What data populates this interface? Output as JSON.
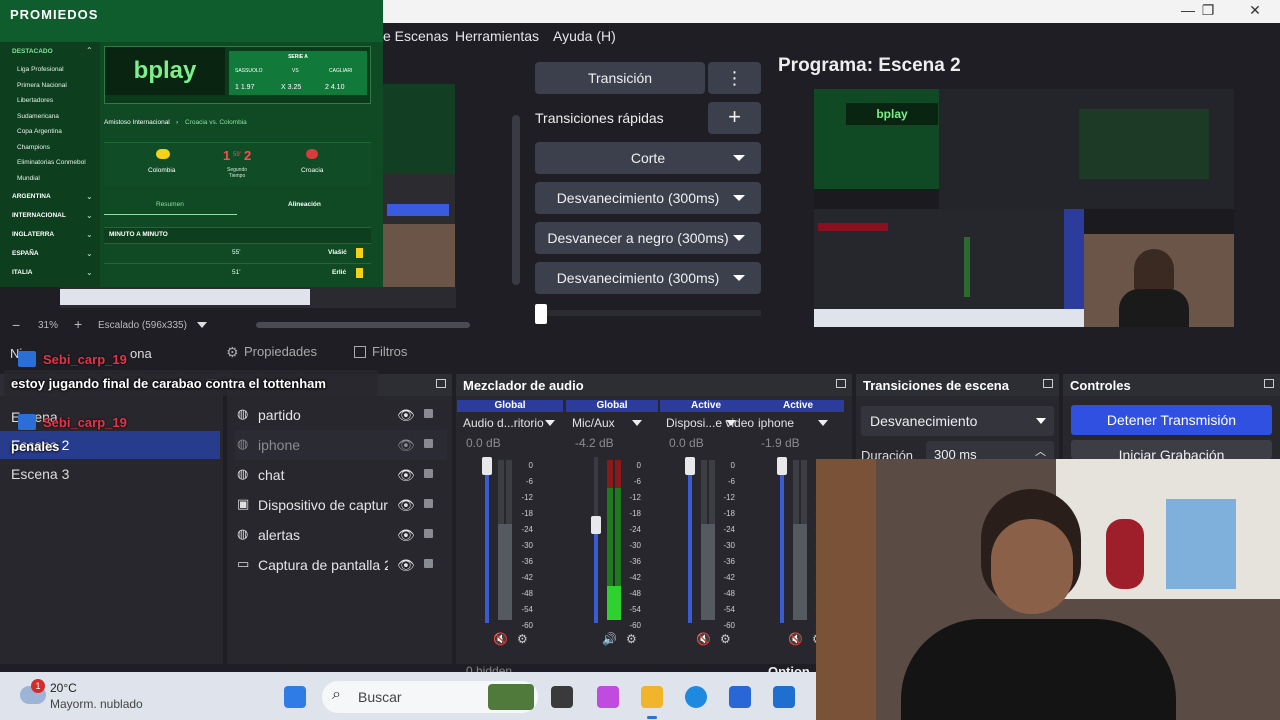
{
  "app": {
    "menu": [
      "e Escenas",
      "Herramientas",
      "Ayuda (H)"
    ],
    "program_title": "Programa: Escena 2"
  },
  "promiedos": {
    "logo": "PROMIEDOS",
    "sidebar_header": "DESTACADO",
    "sidebar_items": [
      "Liga Profesional",
      "Primera Nacional",
      "Libertadores",
      "Sudamericana",
      "Copa Argentina",
      "Champions",
      "Eliminatorias Conmebol",
      "Mundial"
    ],
    "sidebar_categories": [
      "ARGENTINA",
      "INTERNACIONAL",
      "INGLATERRA",
      "ESPAÑA",
      "ITALIA"
    ],
    "banner_brand": "bplay",
    "banner_match": {
      "league": "SERIE A",
      "home": "SASSUOLO",
      "vs": "VS",
      "away": "CAGLIARI",
      "odd1": "1 1.97",
      "oddx": "X 3.25",
      "odd2": "2 4.10"
    },
    "breadcrumb_left": "Amistoso Internacional",
    "breadcrumb_right": "Croacia vs. Colombia",
    "team_home": "Colombia",
    "score_home": "1",
    "minute": "59'",
    "score_away": "2",
    "period": "Segundo Tiempo",
    "team_away": "Croacia",
    "tab_summary": "Resumen",
    "tab_lineup": "Alineación",
    "minute_header": "MINUTO A MINUTO",
    "events": [
      {
        "minute": "55'",
        "player": "Vlašić"
      },
      {
        "minute": "51'",
        "player": "Erlić"
      }
    ]
  },
  "preview": {
    "zoom": "31%",
    "scale_label": "Escalado (596x335)"
  },
  "transitions_panel": {
    "transition_button": "Transición",
    "quick_label": "Transiciones rápidas",
    "quick_items": [
      "Corte",
      "Desvanecimiento (300ms)",
      "Desvanecer a negro (300ms)",
      "Desvanecimiento (300ms)"
    ]
  },
  "props_bar": {
    "no_source": "Ninguna fuente seleccionada",
    "no_source_visible": "Ni",
    "no_source_tail": "ona",
    "properties": "Propiedades",
    "filters": "Filtros"
  },
  "chat": {
    "user": "Sebi_carp_19",
    "message1": "estoy jugando final de carabao contra el tottenham",
    "message2": "penales"
  },
  "scenes": {
    "items": [
      "Escena",
      "Escena 2",
      "Escena 3"
    ]
  },
  "sources": {
    "items": [
      {
        "name": "partido",
        "icon": "globe-icon"
      },
      {
        "name": "iphone",
        "icon": "globe-icon"
      },
      {
        "name": "chat",
        "icon": "globe-icon"
      },
      {
        "name": "Dispositivo de captura",
        "icon": "camera-icon"
      },
      {
        "name": "alertas",
        "icon": "globe-icon"
      },
      {
        "name": "Captura de pantalla 2",
        "icon": "monitor-icon"
      }
    ]
  },
  "mixer": {
    "title": "Mezclador de audio",
    "channels": [
      {
        "tag": "Global",
        "name": "Audio d...ritorio",
        "db": "0.0 dB",
        "muted": true,
        "level": 0.0
      },
      {
        "tag": "Global",
        "name": "Mic/Aux",
        "db": "-4.2 dB",
        "muted": false,
        "level": 0.78
      },
      {
        "tag": "Active",
        "name": "Disposi...e video",
        "db": "0.0 dB",
        "muted": true,
        "level": 0.0
      },
      {
        "tag": "Active",
        "name": "iphone",
        "db": "-1.9 dB",
        "muted": true,
        "level": 0.0
      }
    ],
    "scale": [
      "0",
      "-6",
      "-12",
      "-18",
      "-24",
      "-30",
      "-36",
      "-42",
      "-48",
      "-54",
      "-60"
    ],
    "hidden_label": "0 hidden"
  },
  "scene_transitions": {
    "title": "Transiciones de escena",
    "selected": "Desvanecimiento",
    "duration_label": "Duración",
    "duration_value": "300 ms"
  },
  "controls": {
    "title": "Controles",
    "stop_stream": "Detener Transmisión",
    "start_recording": "Iniciar Grabación",
    "options_partial": "Option"
  },
  "taskbar": {
    "temperature": "20°C",
    "weather": "Mayorm. nublado",
    "badge": "1",
    "search": "Buscar"
  },
  "colors": {
    "accent": "#3f5be3",
    "panel": "#27272d",
    "promiedos_green": "#0f4a24"
  }
}
